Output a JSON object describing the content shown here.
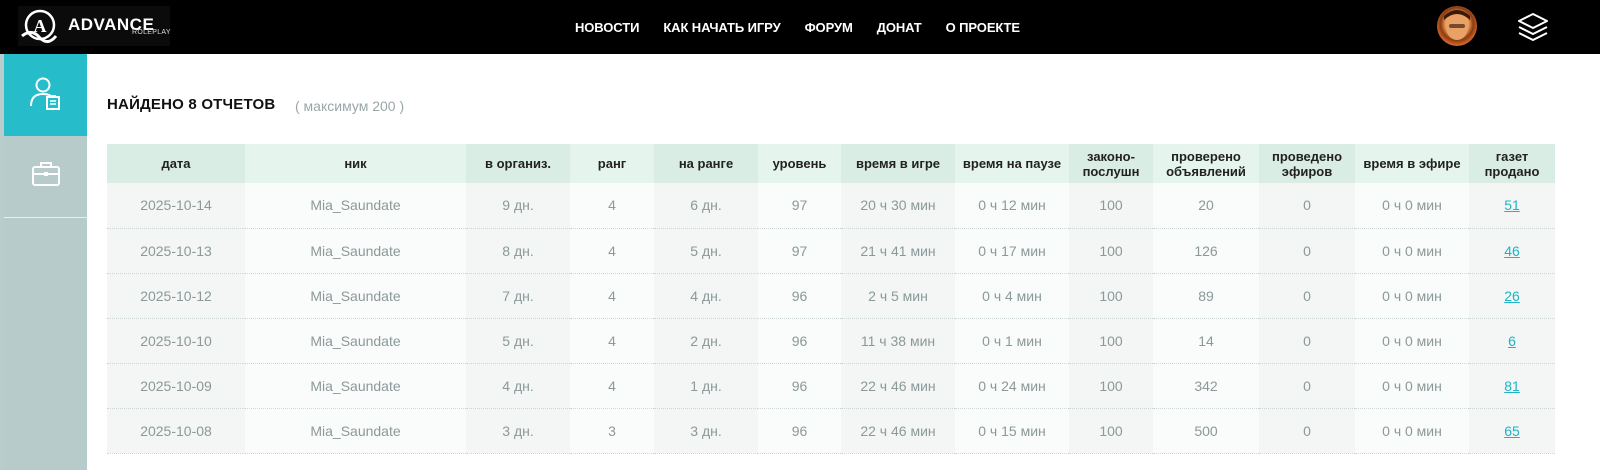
{
  "header": {
    "logo_text": "ADVANCE",
    "logo_sub": "ROLEPLAY",
    "nav": [
      "НОВОСТИ",
      "КАК НАЧАТЬ ИГРУ",
      "ФОРУМ",
      "ДОНАТ",
      "О ПРОЕКТЕ"
    ]
  },
  "sidebar": {
    "items": [
      {
        "icon": "user-report-icon",
        "active": true
      },
      {
        "icon": "briefcase-icon",
        "active": false
      }
    ]
  },
  "main": {
    "title": "НАЙДЕНО 8 ОТЧЕТОВ",
    "subtitle": "( максимум 200 )"
  },
  "table": {
    "headers": [
      "дата",
      "ник",
      "в организ.",
      "ранг",
      "на ранге",
      "уровень",
      "время в игре",
      "время на паузе",
      "законо-\nпослушн",
      "проверено\nобъявлений",
      "проведено\nэфиров",
      "время в эфире",
      "газет\nпродано"
    ],
    "rows": [
      [
        "2025-10-14",
        "Mia_Saundate",
        "9 дн.",
        "4",
        "6 дн.",
        "97",
        "20 ч 30 мин",
        "0 ч 12 мин",
        "100",
        "20",
        "0",
        "0 ч 0 мин",
        "51"
      ],
      [
        "2025-10-13",
        "Mia_Saundate",
        "8 дн.",
        "4",
        "5 дн.",
        "97",
        "21 ч 41 мин",
        "0 ч 17 мин",
        "100",
        "126",
        "0",
        "0 ч 0 мин",
        "46"
      ],
      [
        "2025-10-12",
        "Mia_Saundate",
        "7 дн.",
        "4",
        "4 дн.",
        "96",
        "2 ч 5 мин",
        "0 ч 4 мин",
        "100",
        "89",
        "0",
        "0 ч 0 мин",
        "26"
      ],
      [
        "2025-10-10",
        "Mia_Saundate",
        "5 дн.",
        "4",
        "2 дн.",
        "96",
        "11 ч 38 мин",
        "0 ч 1 мин",
        "100",
        "14",
        "0",
        "0 ч 0 мин",
        "6"
      ],
      [
        "2025-10-09",
        "Mia_Saundate",
        "4 дн.",
        "4",
        "1 дн.",
        "96",
        "22 ч 46 мин",
        "0 ч 24 мин",
        "100",
        "342",
        "0",
        "0 ч 0 мин",
        "81"
      ],
      [
        "2025-10-08",
        "Mia_Saundate",
        "3 дн.",
        "3",
        "3 дн.",
        "96",
        "22 ч 46 мин",
        "0 ч 15 мин",
        "100",
        "500",
        "0",
        "0 ч 0 мин",
        "65"
      ]
    ]
  }
}
